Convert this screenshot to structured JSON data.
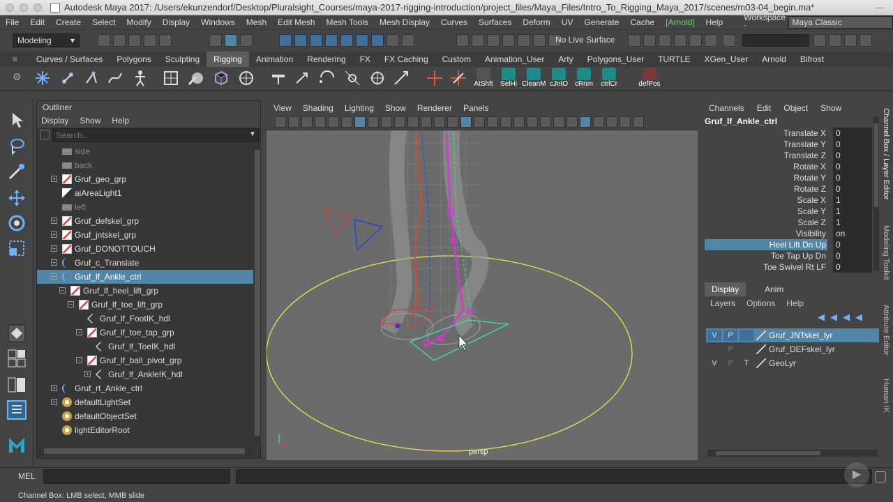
{
  "window": {
    "title": "Autodesk Maya 2017: /Users/ekunzendorf/Desktop/Pluralsight_Courses/maya-2017-rigging-introduction/project_files/Maya_Files/Intro_To_Rigging_Maya_2017/scenes/m03-04_begin.ma*",
    "more": "---"
  },
  "menubar": {
    "items": [
      "File",
      "Edit",
      "Create",
      "Select",
      "Modify",
      "Display",
      "Windows",
      "Mesh",
      "Edit Mesh",
      "Mesh Tools",
      "Mesh Display",
      "Curves",
      "Surfaces",
      "Deform",
      "UV",
      "Generate",
      "Cache",
      "[Arnold]",
      "Help"
    ],
    "workspace_label": "Workspace :",
    "workspace_value": "Maya Classic"
  },
  "statusline": {
    "mode": "Modeling",
    "live_surface": "No Live Surface"
  },
  "shelf": {
    "tabs": [
      "Curves / Surfaces",
      "Polygons",
      "Sculpting",
      "Rigging",
      "Animation",
      "Rendering",
      "FX",
      "FX Caching",
      "Custom",
      "Animation_User",
      "Arty",
      "Polygons_User",
      "TURTLE",
      "XGen_User",
      "Arnold",
      "Bifrost"
    ],
    "active_tab": "Rigging",
    "buttons": [
      "AtShft",
      "SelHi",
      "CleanM",
      "cJntO",
      "cRnm",
      "ctrlCr",
      "defPos"
    ]
  },
  "outliner": {
    "title": "Outliner",
    "menu": [
      "Display",
      "Show",
      "Help"
    ],
    "search_placeholder": "Search...",
    "rows": [
      {
        "label": "side",
        "dim": true,
        "icon": "camera-icon"
      },
      {
        "label": "back",
        "dim": true,
        "icon": "camera-icon"
      },
      {
        "label": "Gruf_geo_grp",
        "icon": "group-icon"
      },
      {
        "label": "aiAreaLight1",
        "icon": "light-icon"
      },
      {
        "label": "left",
        "dim": true,
        "icon": "camera-icon"
      },
      {
        "label": "Gruf_defskel_grp",
        "icon": "group-icon"
      },
      {
        "label": "Gruf_jntskel_grp",
        "icon": "group-icon"
      },
      {
        "label": "Gruf_DONOTTOUCH",
        "icon": "group-icon"
      },
      {
        "label": "Gruf_c_Translate",
        "icon": "curve-icon"
      },
      {
        "label": "Gruf_lf_Ankle_ctrl",
        "icon": "curve-icon",
        "selected": true
      },
      {
        "label": "Gruf_lf_heel_lift_grp",
        "icon": "group-icon"
      },
      {
        "label": "Gruf_lf_toe_lift_grp",
        "icon": "group-icon"
      },
      {
        "label": "Gruf_lf_FootIK_hdl",
        "icon": "ik-handle-icon"
      },
      {
        "label": "Gruf_lf_toe_tap_grp",
        "icon": "group-icon"
      },
      {
        "label": "Gruf_lf_ToeIK_hdl",
        "icon": "ik-handle-icon"
      },
      {
        "label": "Gruf_lf_ball_pivot_grp",
        "icon": "group-icon"
      },
      {
        "label": "Gruf_lf_AnkleIK_hdl",
        "icon": "ik-handle-icon"
      },
      {
        "label": "Gruf_rt_Ankle_ctrl",
        "icon": "curve-icon"
      },
      {
        "label": "defaultLightSet",
        "icon": "set-icon"
      },
      {
        "label": "defaultObjectSet",
        "icon": "set-icon"
      },
      {
        "label": "lightEditorRoot",
        "icon": "set-icon"
      }
    ]
  },
  "viewport": {
    "menu": [
      "View",
      "Shading",
      "Lighting",
      "Show",
      "Renderer",
      "Panels"
    ],
    "camera_label": "persp"
  },
  "channel_box": {
    "menu": [
      "Channels",
      "Edit",
      "Object",
      "Show"
    ],
    "node": "Gruf_lf_Ankle_ctrl",
    "attributes": [
      {
        "name": "Translate X",
        "value": "0"
      },
      {
        "name": "Translate Y",
        "value": "0"
      },
      {
        "name": "Translate Z",
        "value": "0"
      },
      {
        "name": "Rotate X",
        "value": "0"
      },
      {
        "name": "Rotate Y",
        "value": "0"
      },
      {
        "name": "Rotate Z",
        "value": "0"
      },
      {
        "name": "Scale X",
        "value": "1"
      },
      {
        "name": "Scale Y",
        "value": "1"
      },
      {
        "name": "Scale Z",
        "value": "1"
      },
      {
        "name": "Visibility",
        "value": "on"
      },
      {
        "name": "Heel Lift Dn Up",
        "value": "0",
        "highlighted": true
      },
      {
        "name": "Toe Tap Up Dn",
        "value": "0"
      },
      {
        "name": "Toe Swivel Rt LF",
        "value": "0"
      }
    ]
  },
  "layer_editor": {
    "tabs": [
      "Display",
      "Anim"
    ],
    "menu": [
      "Layers",
      "Options",
      "Help"
    ],
    "layers": [
      {
        "v": "V",
        "p": "P",
        "t": "",
        "name": "Gruf_JNTskel_lyr",
        "selected": true
      },
      {
        "v": "",
        "p": "P",
        "t": "",
        "name": "Gruf_DEFskel_lyr"
      },
      {
        "v": "V",
        "p": "P",
        "t": "T",
        "name": "GeoLyr"
      }
    ]
  },
  "side_tabs": [
    "Channel Box / Layer Editor",
    "Modeling Toolkit",
    "Attribute Editor",
    "Human IK"
  ],
  "command_line": {
    "label": "MEL"
  },
  "help_line": "Channel Box: LMB select, MMB slide"
}
